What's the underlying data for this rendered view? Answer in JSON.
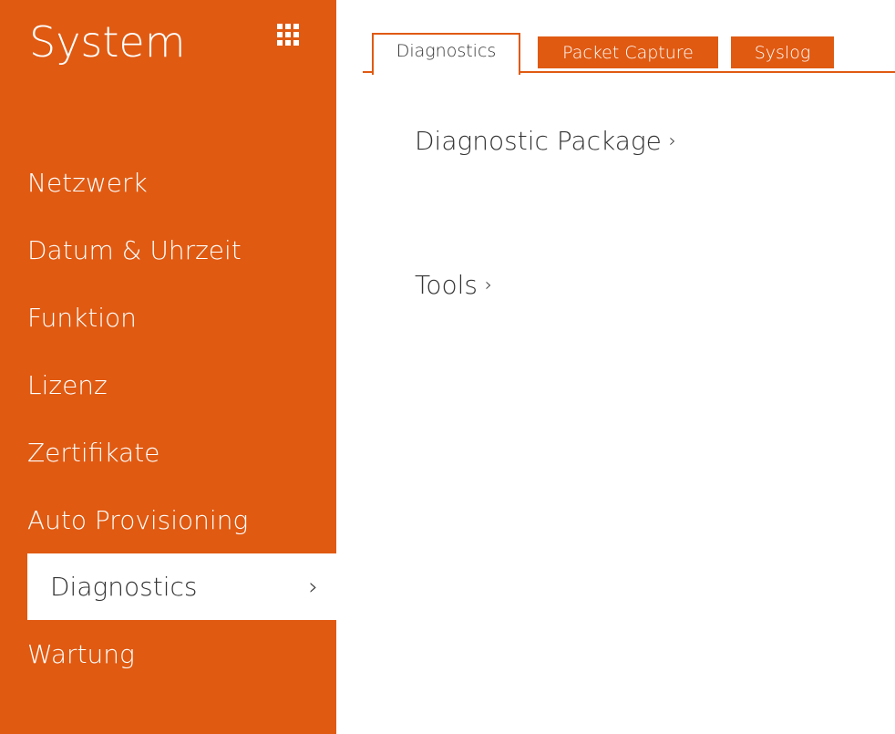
{
  "sidebar": {
    "title": "System",
    "menu_icon": "grid-icon",
    "items": [
      {
        "label": "Netzwerk",
        "active": false
      },
      {
        "label": "Datum & Uhrzeit",
        "active": false
      },
      {
        "label": "Funktion",
        "active": false
      },
      {
        "label": "Lizenz",
        "active": false
      },
      {
        "label": "Zertifikate",
        "active": false
      },
      {
        "label": "Auto Provisioning",
        "active": false
      },
      {
        "label": "Diagnostics",
        "active": true,
        "chevron": "›"
      },
      {
        "label": "Wartung",
        "active": false
      }
    ]
  },
  "tabs": [
    {
      "label": "Diagnostics",
      "active": true
    },
    {
      "label": "Packet Capture",
      "active": false
    },
    {
      "label": "Syslog",
      "active": false
    }
  ],
  "content": {
    "sections": [
      {
        "label": "Diagnostic Package",
        "chevron": "›"
      },
      {
        "label": "Tools",
        "chevron": "›"
      }
    ]
  },
  "colors": {
    "accent": "#e05a12",
    "text_dark": "#333333",
    "background": "#ffffff"
  }
}
